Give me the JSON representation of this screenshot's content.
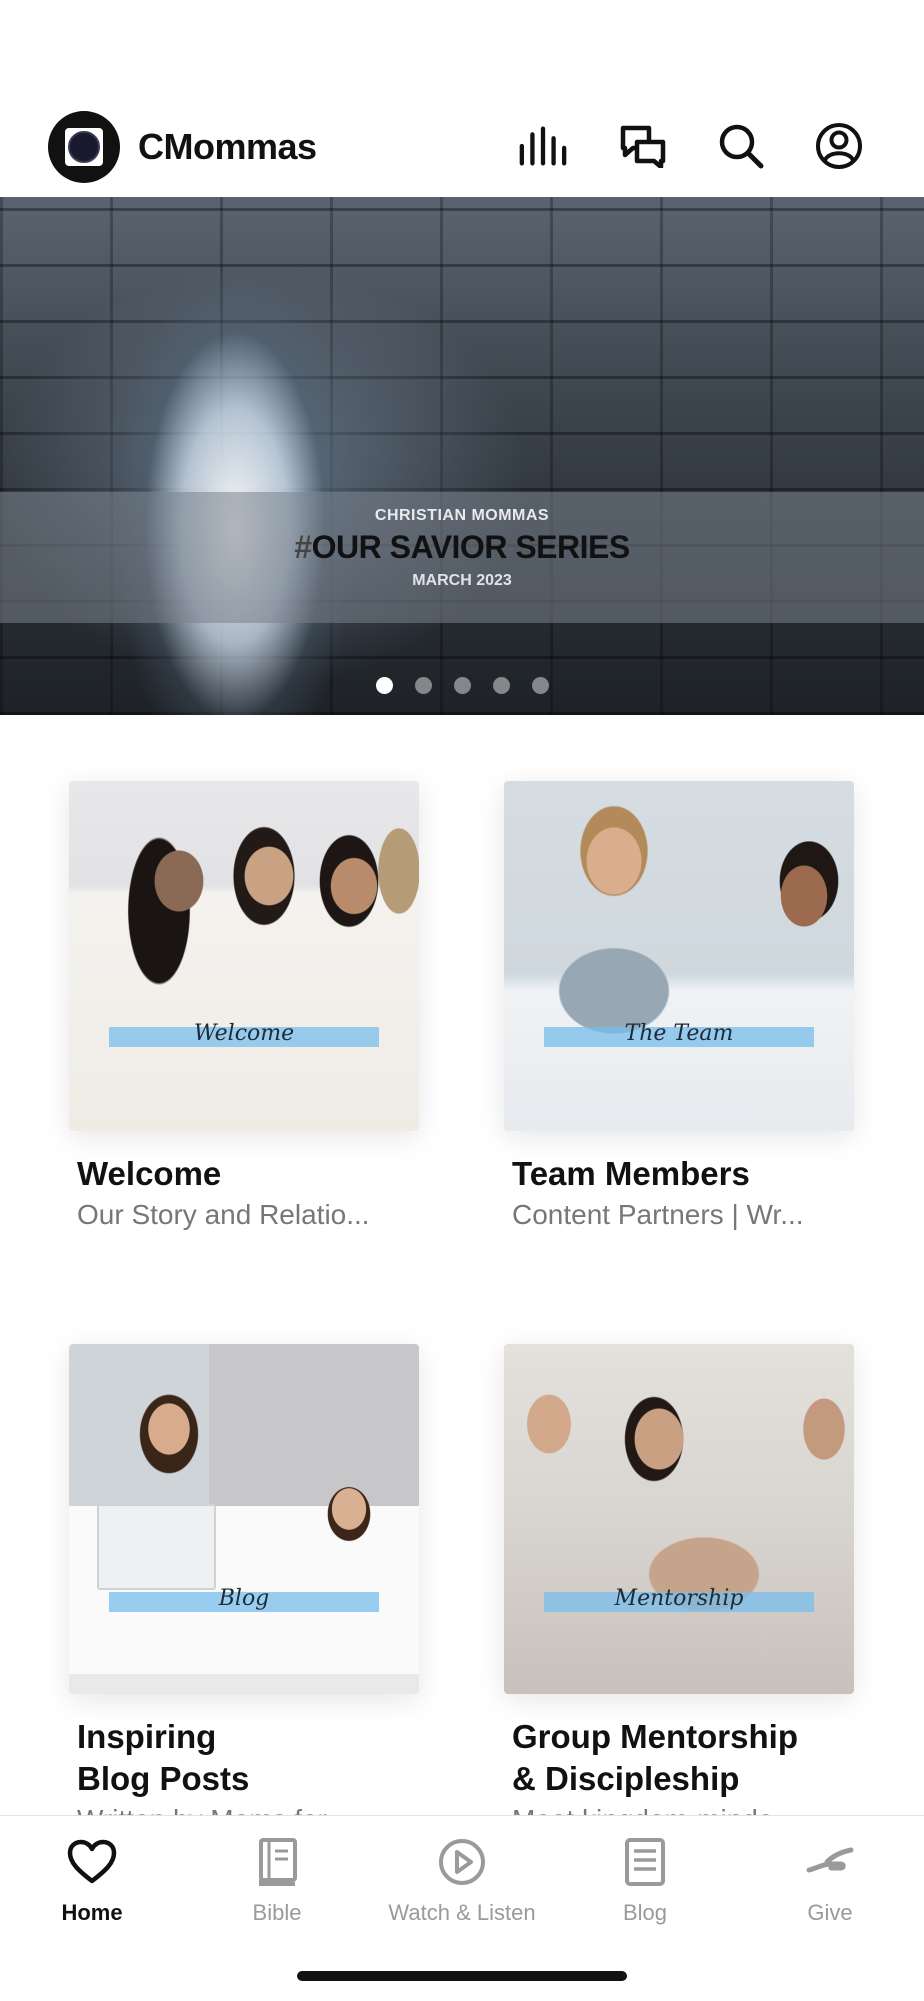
{
  "header": {
    "app_title": "CMommas",
    "icons": [
      "stats-icon",
      "chat-icon",
      "search-icon",
      "profile-icon"
    ]
  },
  "banner": {
    "top_text": "CHRISTIAN MOMMAS",
    "hash": "#",
    "main_text": "OUR SAVIOR SERIES",
    "sub_text": "MARCH 2023",
    "slide_count": 5,
    "active_slide": 1
  },
  "cards": [
    {
      "overlay": "Welcome",
      "title": "Welcome",
      "subtitle": "Our Story and Relatio..."
    },
    {
      "overlay": "The Team",
      "title": "Team Members",
      "subtitle": "Content Partners | Wr..."
    },
    {
      "overlay": "Blog",
      "title_line1": "Inspiring",
      "title_line2": "Blog Posts",
      "subtitle": "Written by Moms for..."
    },
    {
      "overlay": "Mentorship",
      "title_line1": "Group Mentorship",
      "title_line2": "& Discipleship",
      "subtitle": "Meet kingdom-minde..."
    }
  ],
  "tabs": [
    {
      "label": "Home",
      "icon": "heart-icon",
      "active": true
    },
    {
      "label": "Bible",
      "icon": "book-icon",
      "active": false
    },
    {
      "label": "Watch & Listen",
      "icon": "play-icon",
      "active": false
    },
    {
      "label": "Blog",
      "icon": "document-icon",
      "active": false
    },
    {
      "label": "Give",
      "icon": "give-icon",
      "active": false
    }
  ],
  "colors": {
    "accent": "#111111",
    "inactive": "#9a9a9a",
    "stripe": "#78bee8"
  }
}
